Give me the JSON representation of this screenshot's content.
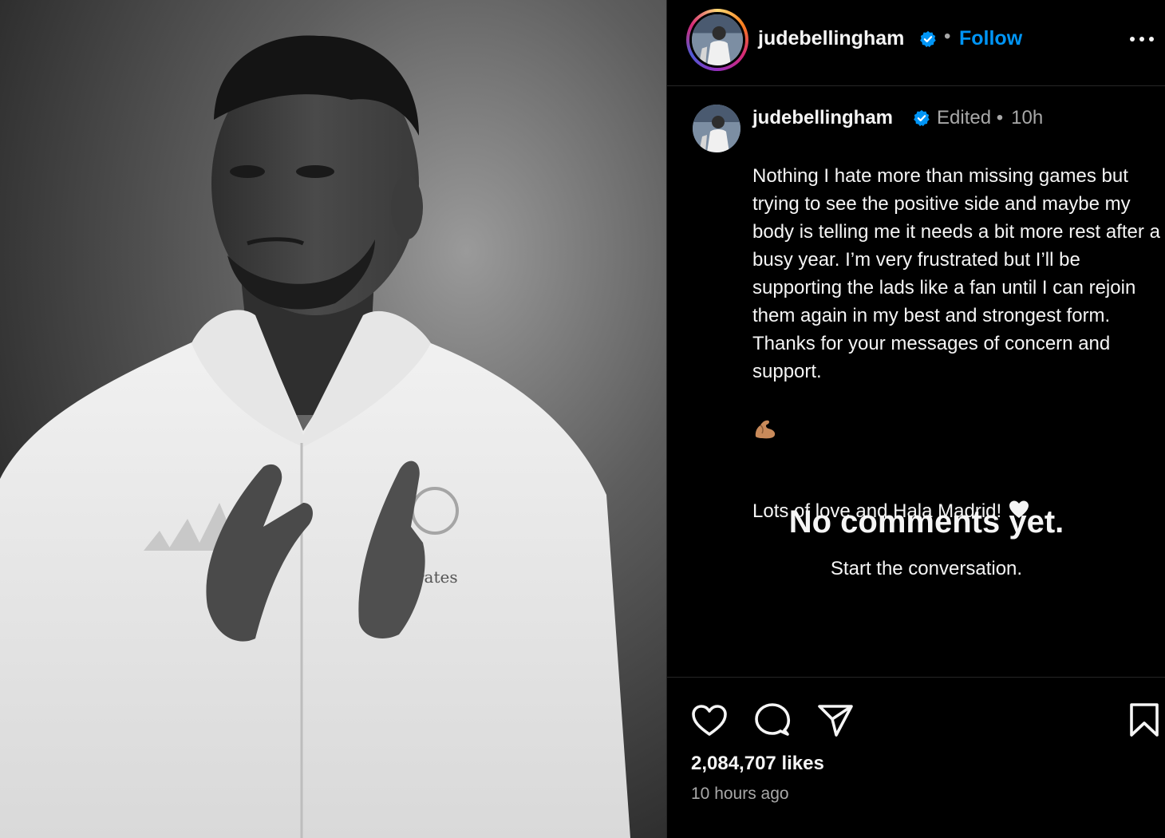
{
  "post": {
    "username": "judebellingham",
    "follow_label": "Follow",
    "separator": "•",
    "photo_text": "rates"
  },
  "caption": {
    "username": "judebellingham",
    "edited_label": "Edited •",
    "time": "10h",
    "text": "Nothing I hate more than missing games but trying to see the positive side and maybe my body is telling me it needs a bit more rest after a busy year. I’m very frustrated but I’ll be supporting the lads like a fan until I can rejoin them again in my best and strongest form. Thanks for your messages of concern and support.",
    "emoji_arm": "flexed-biceps",
    "closing": "Lots of love and Hala Madrid!",
    "emoji_heart": "white-heart"
  },
  "comments": {
    "empty_title": "No comments yet.",
    "empty_subtitle": "Start the conversation."
  },
  "actions": {
    "likes": "2,084,707 likes",
    "timestamp": "10 hours ago"
  },
  "colors": {
    "background": "#000000",
    "text": "#f5f5f5",
    "secondary_text": "#a8a8a8",
    "follow_blue": "#0095f6",
    "verified_blue": "#0095f6",
    "divider": "#262626"
  },
  "icons": [
    "more-options-icon",
    "verified-badge-icon",
    "heart-icon",
    "comment-icon",
    "share-icon",
    "bookmark-icon"
  ]
}
